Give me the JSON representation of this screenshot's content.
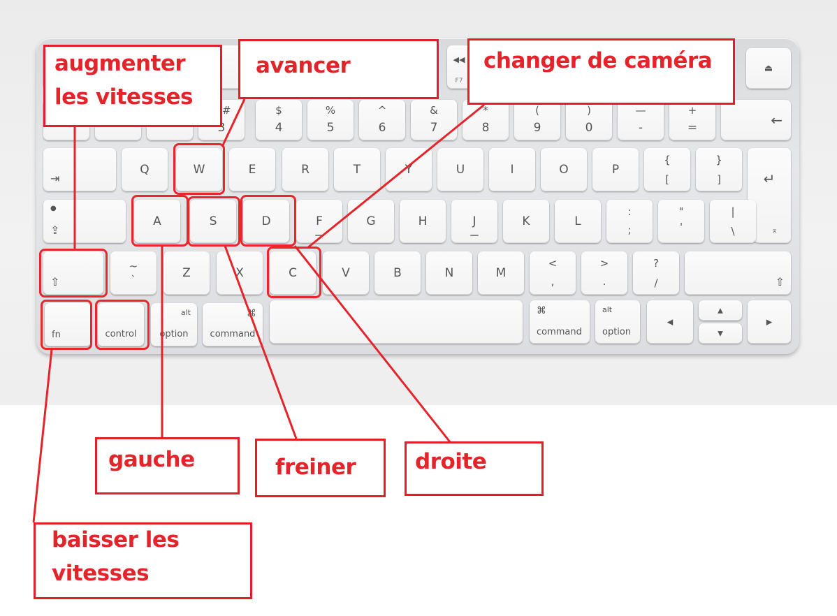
{
  "labels": {
    "gear_up": [
      "augmenter",
      "les vitesses"
    ],
    "forward": "avancer",
    "camera": "changer de caméra",
    "left": "gauche",
    "brake": "freiner",
    "right": "droite",
    "gear_down": [
      "baisser les",
      "vitesses"
    ]
  },
  "keys": {
    "f7": "F7",
    "row_num": {
      "k3_top": "£ #",
      "k3": "3",
      "k4_top": "$",
      "k4": "4",
      "k5_top": "%",
      "k5": "5",
      "k6_top": "^",
      "k6": "6",
      "k7_top": "&",
      "k7": "7",
      "k8_top": "*",
      "k8": "8",
      "k9_top": "(",
      "k9": "9",
      "k0_top": ")",
      "k0": "0",
      "minus_top": "—",
      "minus": "-",
      "plus_top": "+",
      "equals": "="
    },
    "q": "Q",
    "w": "W",
    "e": "E",
    "r": "R",
    "t": "T",
    "y": "Y",
    "u": "U",
    "i": "I",
    "o": "O",
    "p": "P",
    "lbrace": "{",
    "lbracket": "[",
    "rbrace": "}",
    "rbracket": "]",
    "a": "A",
    "s": "S",
    "d": "D",
    "f": "F",
    "g": "G",
    "h": "H",
    "j": "J",
    "k": "K",
    "l": "L",
    "colon": ":",
    "semicolon": ";",
    "dquote": "\"",
    "squote": "'",
    "pipe": "|",
    "backslash": "\\",
    "tilde": "~",
    "backtick": "`",
    "z": "Z",
    "x": "X",
    "c": "C",
    "v": "V",
    "b": "B",
    "n": "N",
    "m": "M",
    "lt": "<",
    "comma": ",",
    "gt": ">",
    "period": ".",
    "question": "?",
    "slash": "/",
    "fn": "fn",
    "control": "control",
    "alt": "alt",
    "option": "option",
    "cmd_symbol": "⌘",
    "command": "command"
  },
  "icons": [
    "backspace-icon",
    "tab-icon",
    "return-icon",
    "caps-lock-icon",
    "shift-icon",
    "eject-icon",
    "rewind-icon",
    "arrow-left-icon",
    "arrow-right-icon",
    "arrow-up-icon",
    "arrow-down-icon"
  ],
  "colors": {
    "annotation": "#e3252b"
  }
}
